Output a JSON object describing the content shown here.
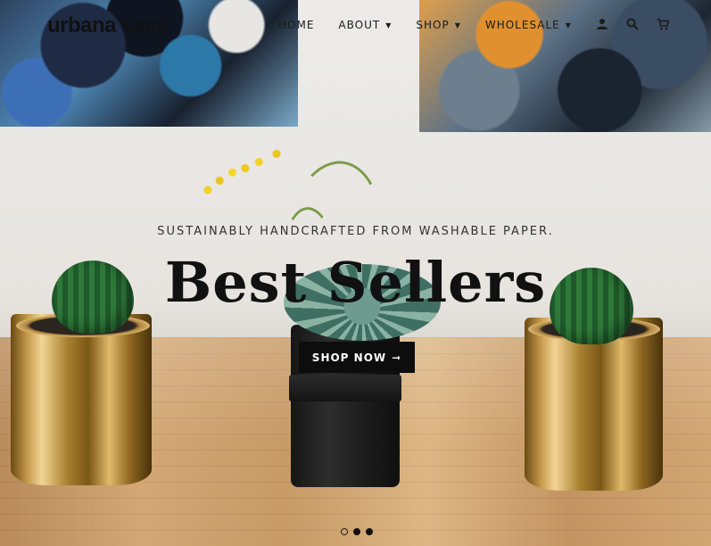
{
  "brand": {
    "logo_text": "urbana sacs"
  },
  "nav": {
    "items": [
      {
        "label": "HOME",
        "dropdown": false
      },
      {
        "label": "ABOUT",
        "dropdown": true
      },
      {
        "label": "SHOP",
        "dropdown": true
      },
      {
        "label": "WHOLESALE",
        "dropdown": true
      }
    ],
    "caret": "▼"
  },
  "header_icons": [
    "account-icon",
    "search-icon",
    "cart-icon"
  ],
  "hero": {
    "tagline": "SUSTAINABLY HANDCRAFTED FROM WASHABLE PAPER.",
    "headline": "Best Sellers",
    "cta_label": "SHOP NOW",
    "cta_arrow": "➞"
  },
  "slider": {
    "slide_count": 3,
    "active_index": 0
  },
  "colors": {
    "cta_bg": "#0d0d0d",
    "cta_text": "#ffffff",
    "text": "#111111"
  }
}
